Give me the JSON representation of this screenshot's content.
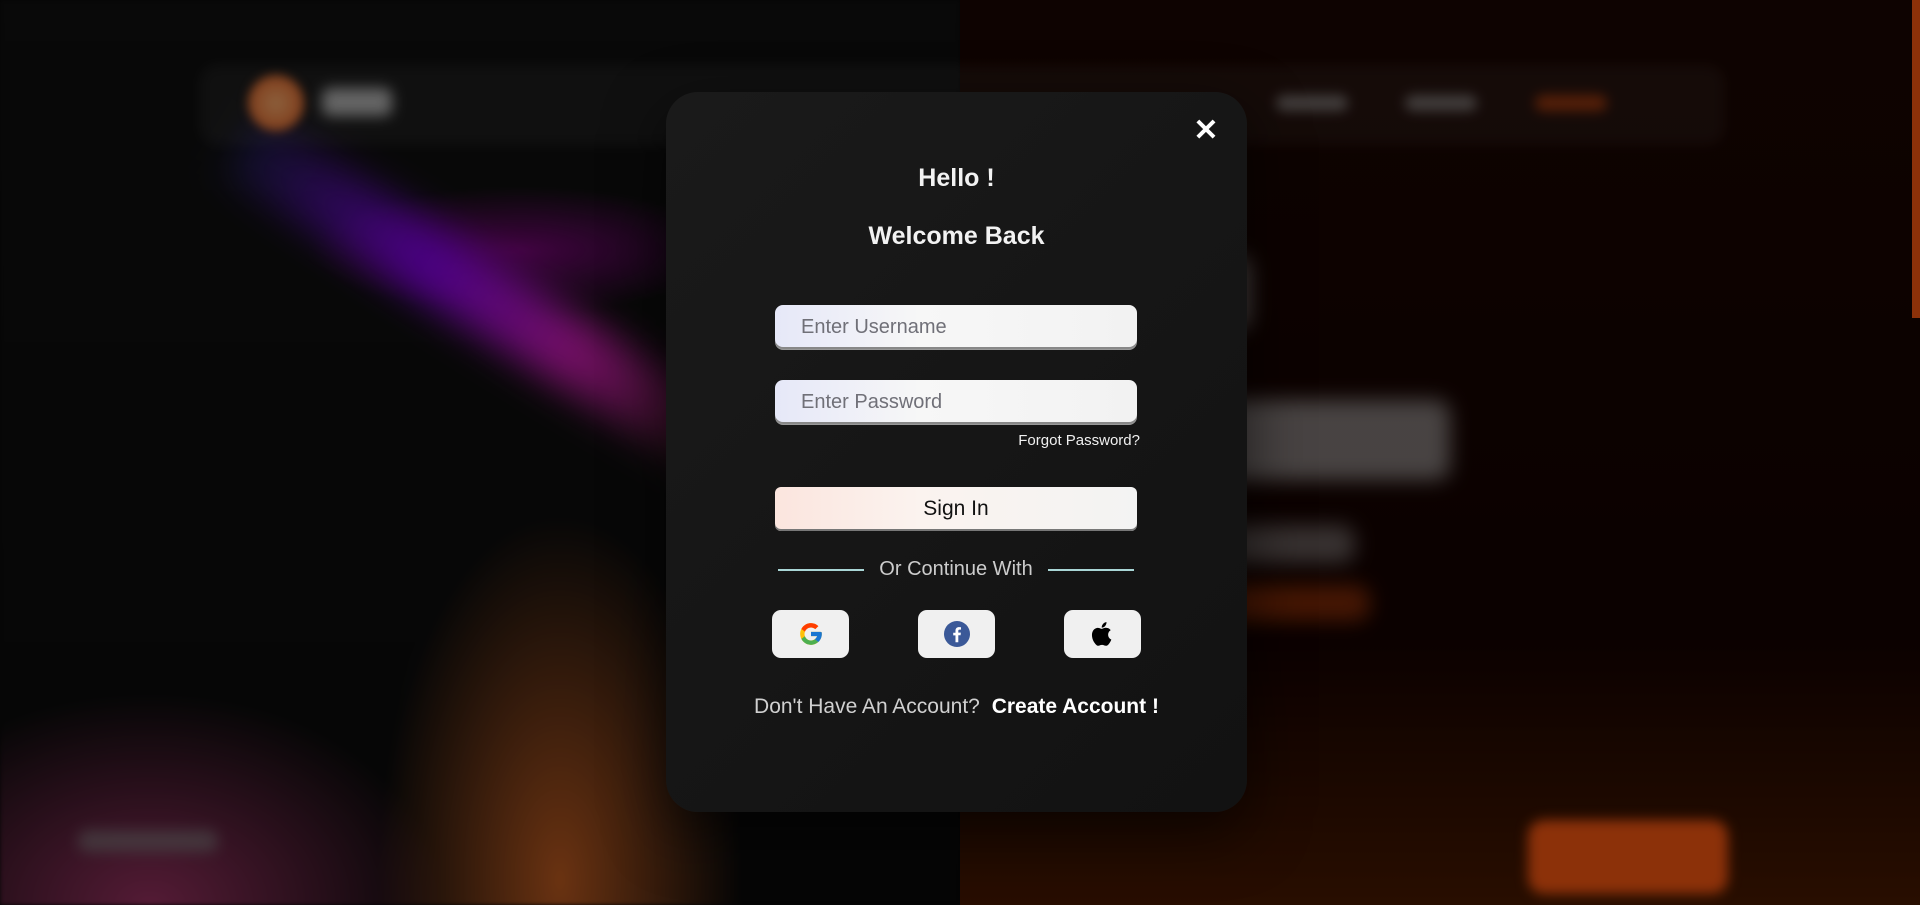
{
  "modal": {
    "close_icon": "close-icon",
    "greeting": "Hello !",
    "subtitle": "Welcome Back",
    "username_placeholder": "Enter Username",
    "username_value": "",
    "password_placeholder": "Enter Password",
    "password_value": "",
    "forgot_password": "Forgot Password?",
    "signin_label": "Sign In",
    "divider_text": "Or Continue With",
    "social": [
      {
        "name": "google",
        "icon": "google-icon"
      },
      {
        "name": "facebook",
        "icon": "facebook-icon"
      },
      {
        "name": "apple",
        "icon": "apple-icon"
      }
    ],
    "signup_prompt": "Don't Have An Account?",
    "signup_link": "Create Account !"
  },
  "colors": {
    "accent": "#ff5a12",
    "modal_bg": "#161616",
    "divider": "#a9d6d6"
  }
}
